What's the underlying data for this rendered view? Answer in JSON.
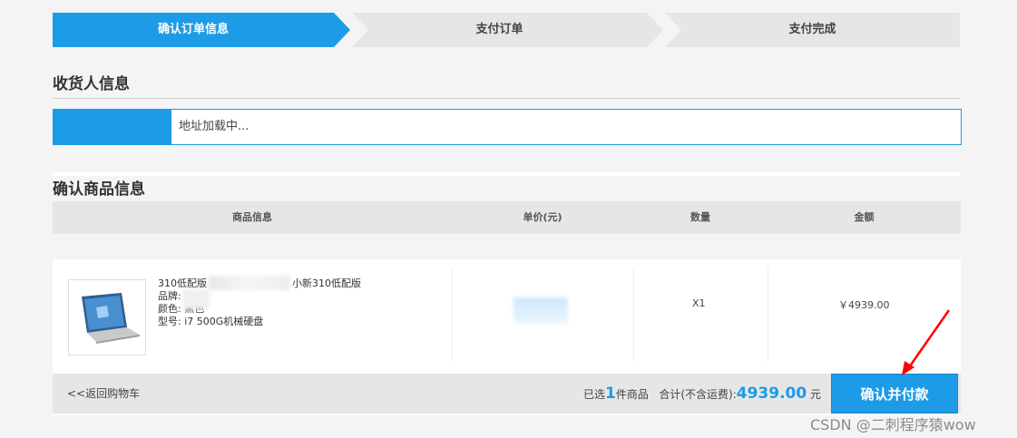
{
  "steps": [
    {
      "label": "确认订单信息",
      "active": true
    },
    {
      "label": "支付订单",
      "active": false
    },
    {
      "label": "支付完成",
      "active": false
    }
  ],
  "receiver": {
    "title": "收货人信息",
    "address_text": "地址加载中..."
  },
  "goods": {
    "title": "确认商品信息",
    "columns": [
      "商品信息",
      "单价(元)",
      "数量",
      "金额"
    ],
    "item": {
      "name_line": "310低配版",
      "name_tail": "小新310低配版",
      "brand_label": "品牌:",
      "color_line": "颜色: 黑色",
      "model_line": "型号: i7 500G机械硬盘",
      "quantity": "X1",
      "amount": "￥4939.00"
    }
  },
  "footer": {
    "back_label": "<<返回购物车",
    "selected_prefix": "已选",
    "selected_count": "1",
    "selected_suffix": "件商品",
    "total_label": "合计(不含运费):",
    "total_value": "4939.00",
    "currency": "元",
    "pay_button": "确认并付款"
  },
  "watermark": "CSDN @二刺程序猿wow",
  "colors": {
    "accent": "#1e9be6",
    "annotation_arrow": "#ff0000"
  }
}
